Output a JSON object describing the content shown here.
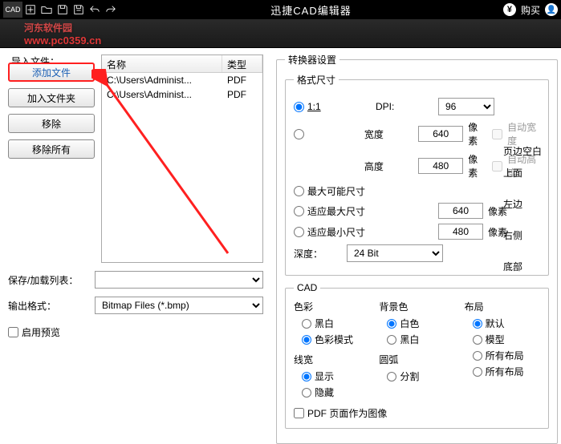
{
  "titlebar": {
    "app_badge": "CAD",
    "title": "迅捷CAD编辑器",
    "buy": "购买"
  },
  "watermark": {
    "text": "河东软件园",
    "url": "www.pc0359.cn"
  },
  "left": {
    "import_label": "导入文件：",
    "buttons": {
      "add_file": "添加文件",
      "add_folder": "加入文件夹",
      "remove": "移除",
      "remove_all": "移除所有"
    },
    "columns": {
      "name": "名称",
      "type": "类型"
    },
    "files": [
      {
        "name": "C:\\Users\\Administ...",
        "type": "PDF"
      },
      {
        "name": "C:\\Users\\Administ...",
        "type": "PDF"
      }
    ],
    "save_load_list": "保存/加载列表：",
    "output_format": "输出格式：",
    "output_format_value": "Bitmap Files (*.bmp)",
    "enable_preview": "启用预览"
  },
  "right": {
    "converter_settings": "转换器设置",
    "format_size": "格式尺寸",
    "opt_1_1": "1:1",
    "dpi_label": "DPI:",
    "dpi_value": "96",
    "width_label": "宽度",
    "width_value": "640",
    "height_label": "高度",
    "height_value": "480",
    "px": "像素",
    "auto_width": "自动宽度",
    "auto_height": "自动高度",
    "max_possible": "最大可能尺寸",
    "fit_max": "适应最大尺寸",
    "fit_max_value": "640",
    "fit_min": "适应最小尺寸",
    "fit_min_value": "480",
    "depth_label": "深度：",
    "depth_value": "24 Bit",
    "margins_header": "页边空白",
    "margins": {
      "top": "上面",
      "left": "左边",
      "right": "右侧",
      "bottom": "底部"
    },
    "cad": "CAD",
    "color_grp": "色彩",
    "color_bw": "黑白",
    "color_mode": "色彩模式",
    "bg_grp": "背景色",
    "bg_white": "白色",
    "bg_black": "黑白",
    "layout_grp": "布局",
    "layout_default": "默认",
    "layout_model": "模型",
    "layout_all": "所有布局",
    "layout_all2": "所有布局",
    "lw_grp": "线宽",
    "lw_show": "显示",
    "lw_hide": "隐藏",
    "arc_grp": "圆弧",
    "arc_split": "分割",
    "pdf_as_image": "PDF 页面作为图像"
  }
}
